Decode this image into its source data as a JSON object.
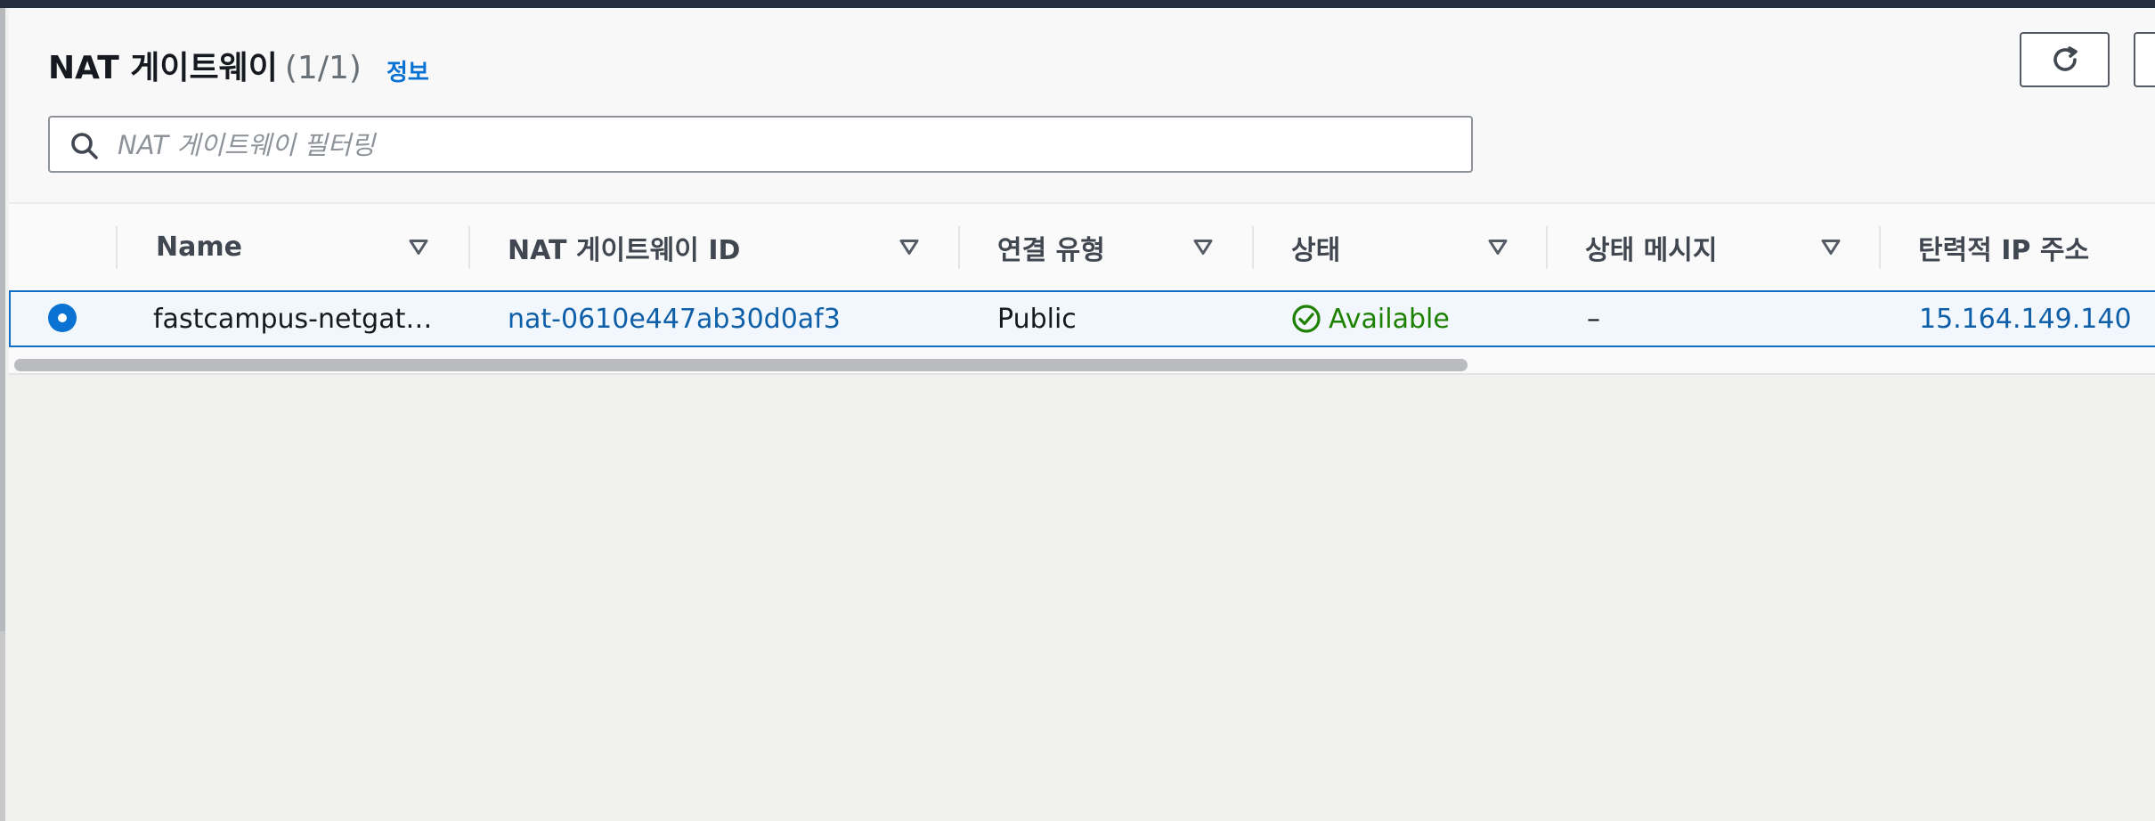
{
  "header": {
    "title": "NAT 게이트웨이",
    "count": "(1/1)",
    "info_link": "정보"
  },
  "toolbar": {
    "refresh_icon": "refresh-icon"
  },
  "search": {
    "placeholder": "NAT 게이트웨이 필터링",
    "value": "",
    "icon": "search-icon"
  },
  "table": {
    "columns": [
      "Name",
      "NAT 게이트웨이 ID",
      "연결 유형",
      "상태",
      "상태 메시지",
      "탄력적 IP 주소"
    ],
    "rows": [
      {
        "selected": true,
        "name": "fastcampus-netgat…",
        "nat_id": "nat-0610e447ab30d0af3",
        "connectivity": "Public",
        "status": "Available",
        "status_message": "–",
        "elastic_ip": "15.164.149.140"
      }
    ]
  },
  "colors": {
    "link": "#0972d3",
    "status_available": "#1d8102",
    "selected_row_border": "#0972d3",
    "topbar": "#232f3e"
  }
}
